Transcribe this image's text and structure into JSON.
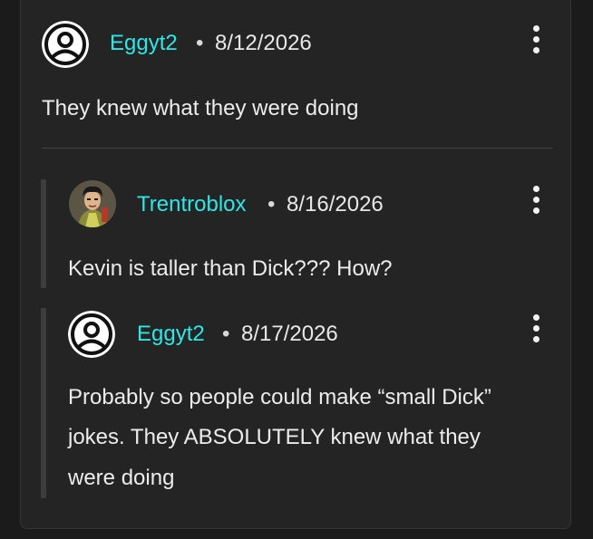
{
  "comments": [
    {
      "username": "Eggyt2",
      "separator": "•",
      "date": "8/12/2026",
      "avatar_icon": "user-circle-icon",
      "text": "They knew what they were doing",
      "menu_icon": "more-vertical-icon"
    }
  ],
  "replies": [
    {
      "username": "Trentroblox",
      "separator": "•",
      "date": "8/16/2026",
      "avatar_icon": "cartoon-character-avatar",
      "text": "Kevin is taller than Dick??? How?",
      "menu_icon": "more-vertical-icon"
    },
    {
      "username": "Eggyt2",
      "separator": "•",
      "date": "8/17/2026",
      "avatar_icon": "user-circle-icon",
      "text_lines": [
        "Probably so people could make “small Dick”",
        "jokes. They ABSOLUTELY knew what they",
        "were doing"
      ],
      "menu_icon": "more-vertical-icon"
    }
  ],
  "colors": {
    "background": "#1b1b1b",
    "panel": "#242424",
    "username": "#2ee6e6",
    "text": "#ececec"
  }
}
